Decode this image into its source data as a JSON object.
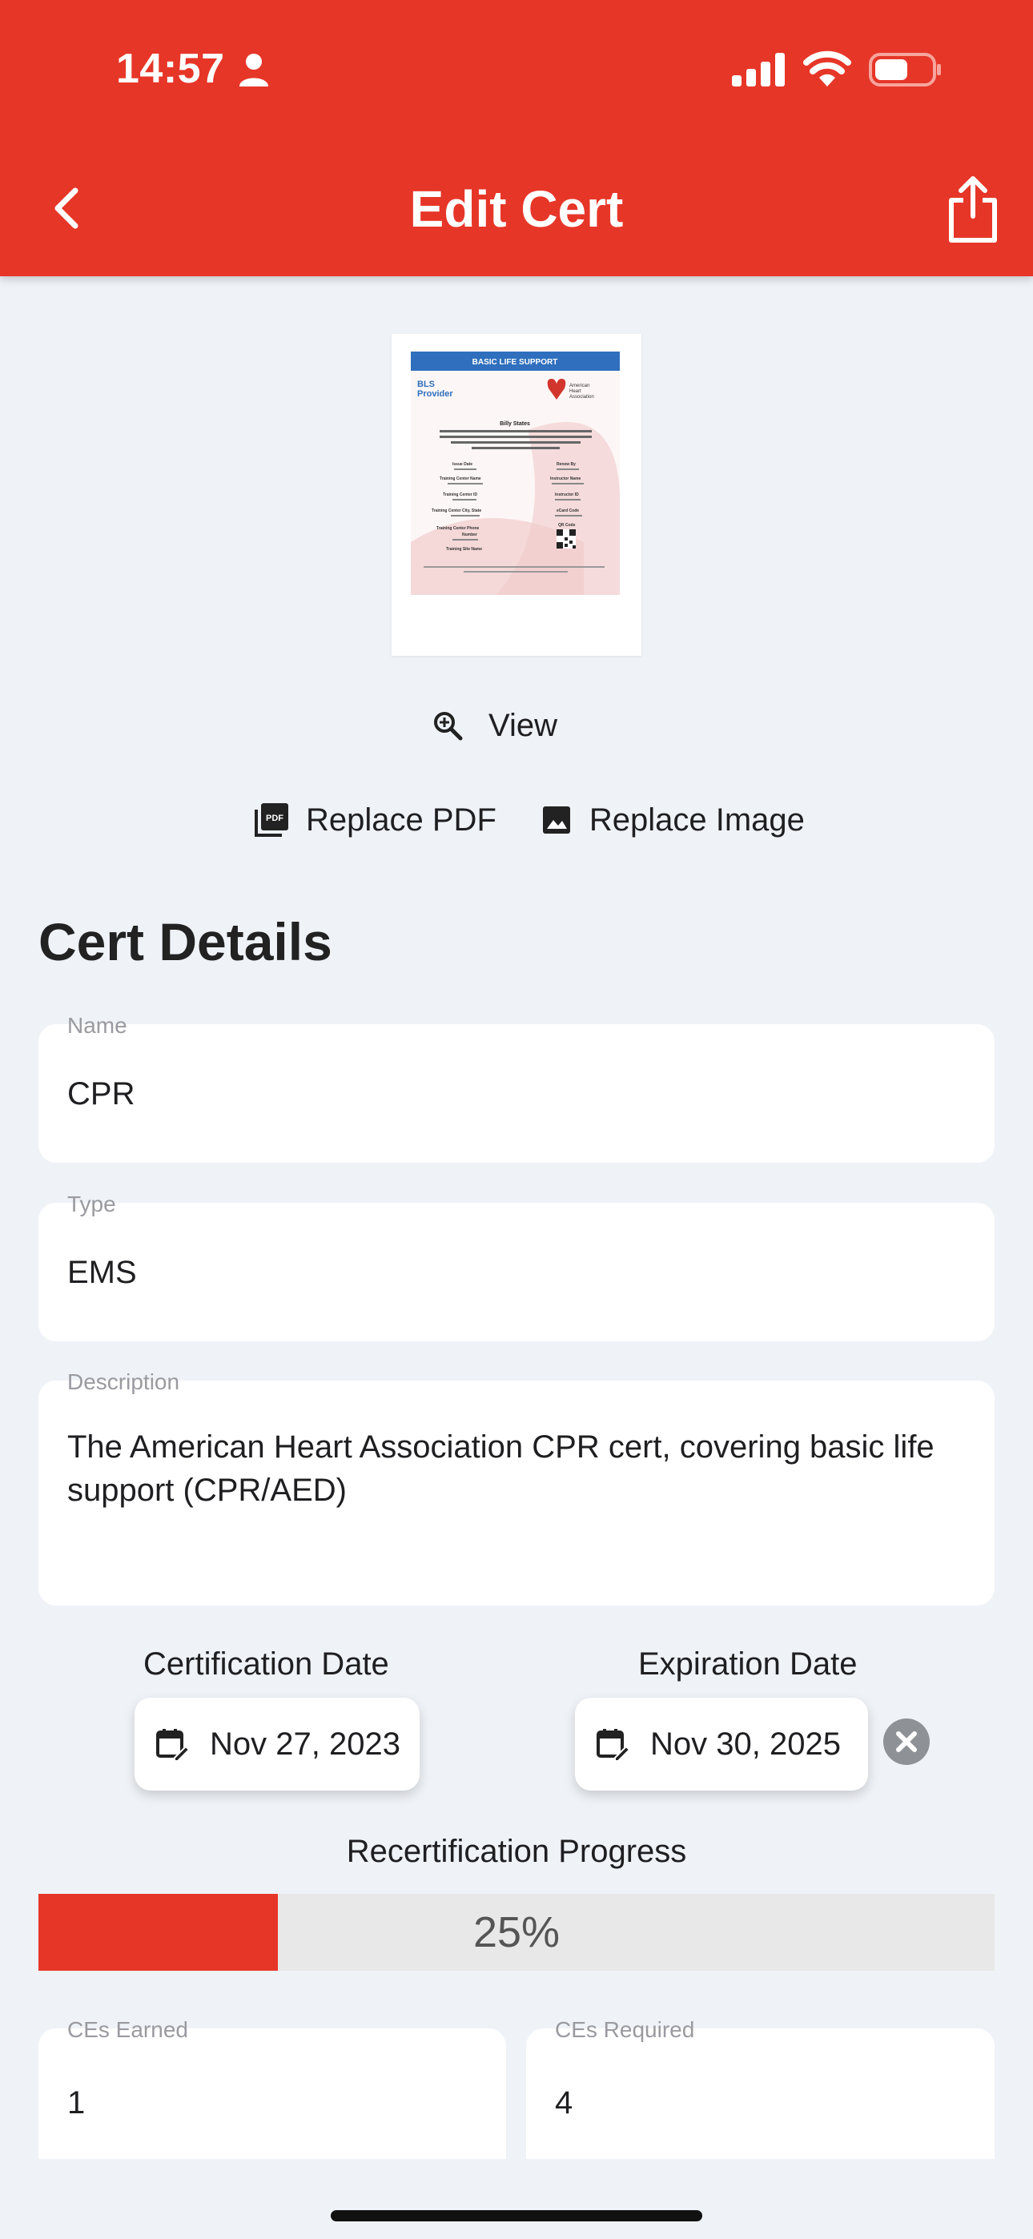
{
  "status_bar": {
    "time": "14:57"
  },
  "header": {
    "title": "Edit Cert"
  },
  "preview_doc": {
    "banner": "BASIC LIFE SUPPORT",
    "provider": "BLS\nProvider",
    "org": "American Heart Association",
    "holder": "Billy States",
    "body": "has successfully completed the cognitive and skills evaluations in accordance with the curriculum of the American Heart Association Basic Life Support (CPR and AED) Program.",
    "fields_left": [
      "Issue Date",
      "Training Center Name",
      "Training Center ID",
      "Training Center City, State",
      "Training Center Phone Number",
      "Training Site Name"
    ],
    "fields_right": [
      "Renew By",
      "Instructor Name",
      "Instructor ID",
      "eCard Code",
      "QR Code"
    ]
  },
  "actions": {
    "view": "View",
    "replace_pdf": "Replace PDF",
    "replace_image": "Replace Image"
  },
  "section": {
    "title": "Cert Details"
  },
  "fields": {
    "name": {
      "label": "Name",
      "value": "CPR"
    },
    "type": {
      "label": "Type",
      "value": "EMS"
    },
    "description": {
      "label": "Description",
      "value": "The American Heart Association CPR cert, covering basic life support (CPR/AED)"
    }
  },
  "dates": {
    "certification": {
      "label": "Certification Date",
      "value": "Nov 27, 2023"
    },
    "expiration": {
      "label": "Expiration Date",
      "value": "Nov 30, 2025"
    }
  },
  "progress": {
    "label": "Recertification Progress",
    "fraction": 0.25,
    "text": "25%"
  },
  "ces": {
    "earned": {
      "label": "CEs Earned",
      "value": "1"
    },
    "required": {
      "label": "CEs Required",
      "value": "4"
    }
  },
  "colors": {
    "accent": "#e63628",
    "background": "#eff2f7"
  }
}
